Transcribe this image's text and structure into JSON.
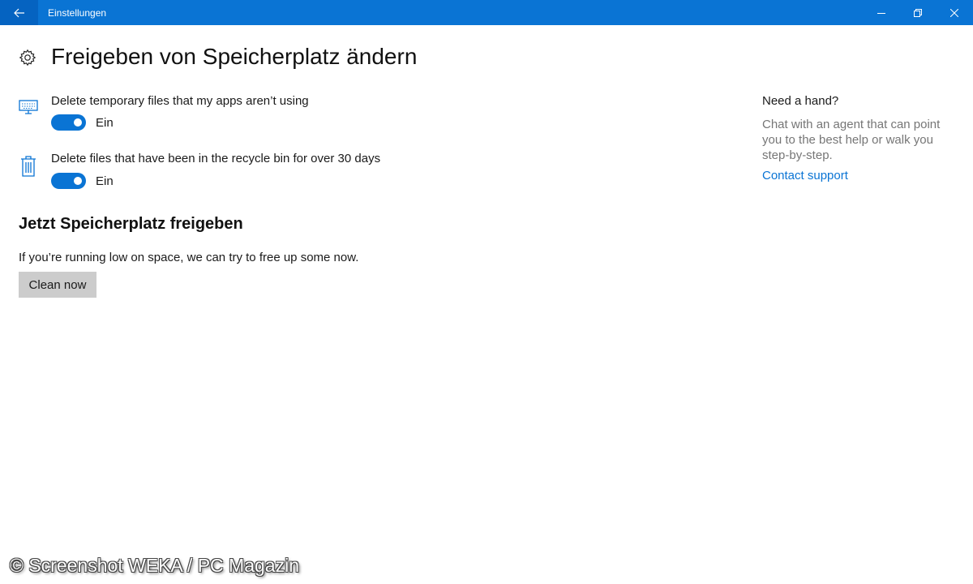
{
  "window": {
    "title": "Einstellungen",
    "accent_color": "#0a74d4",
    "icons": {
      "back": "back-arrow-icon",
      "minimize": "minimize-icon",
      "maximize": "restore-icon",
      "close": "close-icon"
    }
  },
  "page": {
    "title": "Freigeben von Speicherplatz ändern",
    "icon": "gear-icon"
  },
  "settings": [
    {
      "icon": "monitor-icon",
      "label": "Delete temporary files that my apps aren’t using",
      "toggle_state": "Ein",
      "on": true
    },
    {
      "icon": "trash-icon",
      "label": "Delete files that have been in the recycle bin for over 30 days",
      "toggle_state": "Ein",
      "on": true
    }
  ],
  "free_up": {
    "title": "Jetzt Speicherplatz freigeben",
    "description": "If you’re running low on space, we can try to free up some now.",
    "button_label": "Clean now"
  },
  "help": {
    "title": "Need a hand?",
    "description": "Chat with an agent that can point you to the best help or walk you step-by-step.",
    "link_label": "Contact support",
    "link_color": "#0a74d4"
  },
  "watermark": "© Screenshot WEKA / PC Magazin"
}
